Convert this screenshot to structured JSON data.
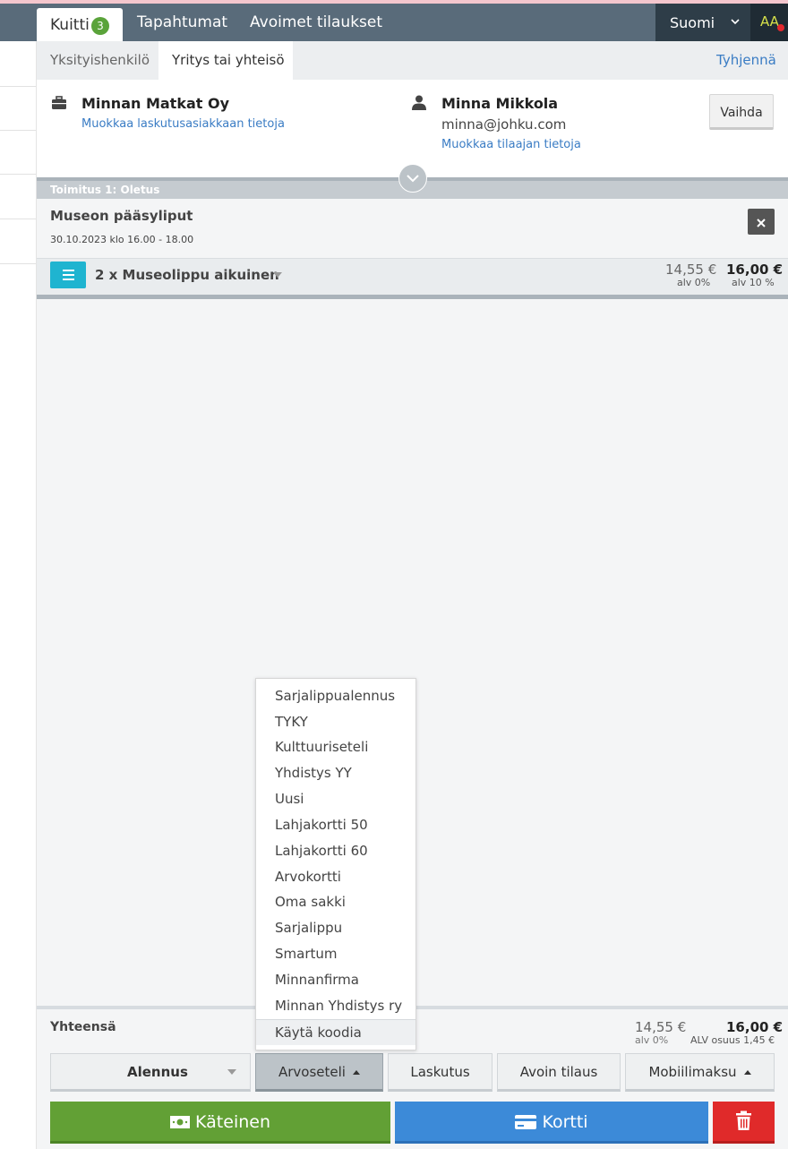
{
  "header": {
    "tabs": [
      {
        "label": "Kuitti",
        "badge": "3",
        "active": true
      },
      {
        "label": "Tapahtumat"
      },
      {
        "label": "Avoimet tilaukset"
      }
    ],
    "language": "Suomi",
    "font_toggle": "AA"
  },
  "customer_tabs": {
    "items": [
      "Yksityishenkilö",
      "Yritys tai yhteisö"
    ],
    "active": "Yritys tai yhteisö",
    "clear_label": "Tyhjennä"
  },
  "customer": {
    "company_name": "Minnan Matkat Oy",
    "company_edit_link": "Muokkaa laskutusasiakkaan tietoja",
    "buyer_name": "Minna Mikkola",
    "buyer_email": "minna@johku.com",
    "buyer_edit_link": "Muokkaa tilaajan tietoja",
    "change_button": "Vaihda"
  },
  "delivery": {
    "label": "Toimitus 1: Oletus",
    "event_title": "Museon pääsyliput",
    "event_date": "30.10.2023 klo 16.00 - 18.00"
  },
  "line_item": {
    "name": "2 x Museolippu aikuinen",
    "net_price": "14,55 €",
    "net_vat": "alv 0%",
    "gross_price": "16,00 €",
    "gross_vat": "alv 10 %"
  },
  "dropdown": {
    "items": [
      "Sarjalippualennus",
      "TYKY",
      "Kulttuuriseteli",
      "Yhdistys YY",
      "Uusi",
      "Lahjakortti 50",
      "Lahjakortti 60",
      "Arvokortti",
      "Oma sakki",
      "Sarjalippu",
      "Smartum",
      "Minnanfirma",
      "Minnan Yhdistys ry",
      "Käytä koodia"
    ],
    "highlighted": "Käytä koodia"
  },
  "totals": {
    "label": "Yhteensä",
    "net": "14,55 €",
    "net_vat": "alv 0%",
    "gross": "16,00 €",
    "gross_vat": "ALV osuus 1,45 €"
  },
  "actions": {
    "discount": "Alennus",
    "voucher": "Arvoseteli",
    "invoice": "Laskutus",
    "open_order": "Avoin tilaus",
    "mobile_pay": "Mobiilimaksu",
    "cash": "Käteinen",
    "card": "Kortti"
  },
  "colors": {
    "topbar": "#596b7a",
    "badge": "#5aa33a",
    "link": "#3a7cc4",
    "menu_button": "#1fb4d0",
    "cash": "#62a035",
    "card": "#3c8ad8",
    "delete": "#e02a2a"
  }
}
